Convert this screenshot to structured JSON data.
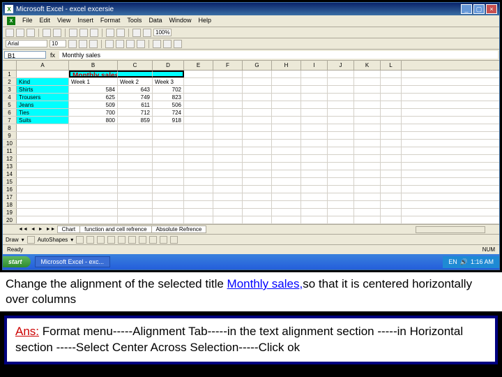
{
  "title": "Microsoft Excel - excel excersie",
  "menus": [
    "File",
    "Edit",
    "View",
    "Insert",
    "Format",
    "Tools",
    "Data",
    "Window",
    "Help"
  ],
  "font": "Arial",
  "fontsize": "10",
  "zoom": "100%",
  "namebox": "B1",
  "formula_label": "fx",
  "formula_val": "Monthly sales",
  "cols": [
    "A",
    "B",
    "C",
    "D",
    "E",
    "F",
    "G",
    "H",
    "I",
    "J",
    "K",
    "L"
  ],
  "rows_count": 20,
  "data": {
    "r1": {
      "b": "Monthly sales"
    },
    "r2": {
      "a": "Kind",
      "b": "Week 1",
      "c": "Week 2",
      "d": "Week 3"
    },
    "r3": {
      "a": "Shirts",
      "b": "584",
      "c": "643",
      "d": "702"
    },
    "r4": {
      "a": "Trousers",
      "b": "625",
      "c": "749",
      "d": "823"
    },
    "r5": {
      "a": "Jeans",
      "b": "509",
      "c": "611",
      "d": "506"
    },
    "r6": {
      "a": "Ties",
      "b": "700",
      "c": "712",
      "d": "724"
    },
    "r7": {
      "a": "Suits",
      "b": "800",
      "c": "859",
      "d": "918"
    }
  },
  "sheet_tabs": [
    "Chart",
    "function and cell refrence",
    "Absolute Refrence"
  ],
  "draw_label": "Draw",
  "autoshapes": "AutoShapes",
  "status": "Ready",
  "num_ind": "NUM",
  "start": "start",
  "task": "Microsoft Excel - exc...",
  "tray_time": "1:16 AM",
  "tray_lang": "EN",
  "question_pre": "Change the alignment of the selected title ",
  "question_kw": "Monthly sales,",
  "question_post": "so that it is centered horizontally over columns",
  "ans_label": "Ans:",
  "ans_text": " Format menu-----Alignment Tab-----in the text alignment section -----in Horizontal section -----Select Center Across Selection-----Click ok"
}
